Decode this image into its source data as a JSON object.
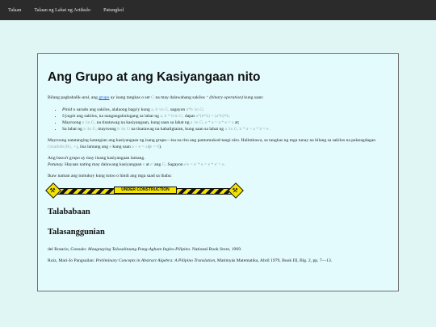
{
  "nav": {
    "items": [
      {
        "label": "Talaan"
      },
      {
        "label": "Talaan ng Lahat ng Artikulo"
      },
      {
        "label": "Patungkol"
      }
    ]
  },
  "article": {
    "title": "Ang Grupo at ang Kasiyangaan nito",
    "intro_before_link": "Bilang pagbabalik-aral, ang ",
    "intro_link": "grupo",
    "intro_after_link": " ay isang tangkas o set ",
    "intro_G": "G",
    "intro_mid": " na may dalawahang sakilos ",
    "intro_star": "*",
    "intro_binop": "(binary operation)",
    "intro_end": " kung saan:",
    "bullets": [
      {
        "term": "Pinid",
        "text_a": " o sarado ang sakilos, alalaong baga'y kung ",
        "math_a": "a, b \\in G,",
        "text_b": " sagayon ",
        "math_b": "a*b \\in G;"
      },
      {
        "term": "Uyugin",
        "text_a": " ang sakilos, na nangangahulugang sa lahat ng ",
        "math_a": "a, b * b\\in G,",
        "text_b": " dapat ",
        "math_b": "a*(b*k) = (a*b)*k;"
      },
      {
        "term": "",
        "text_a": "Mayroong ",
        "math_a": "e \\in G,",
        "text_b": " na tinatawag na kasiyangaan, kung saan sa lahat ng ",
        "math_b": "a \\in G, e * a = a * e = a",
        "text_c": " at;"
      },
      {
        "term": "",
        "text_a": "Sa lahat ng ",
        "math_a": "a \\in G,",
        "text_b": " mayroong ",
        "math_b": "b \\in G",
        "text_c": " na tinatawag na kabaligtaran, kung saan sa lahat ng ",
        "math_c": "a \\in G, b * a = a * b = e ."
      }
    ],
    "para2_a": "Mayroong natatanging katangian ang kasiyangaan ng isang grupo—isa na rito ang pamumukod-tangi nito. Halimbawa, sa tangkas ng mga tunay na bilang sa sakilos na palaragdagan ",
    "para2_math": "(\\mathbb{R}, +)",
    "para2_b": ", iisa lamang ang ",
    "para2_e": "e",
    "para2_c": " kung saan ",
    "para2_math2": "a + e = a",
    "para2_d": " (",
    "para2_math3": "e = 0",
    "para2_end": ").",
    "para3_line1": "Ang bawa't grupo ay may iisang kasiyangaan lamang.",
    "para3_patunay": "Patunay.",
    "para3_line2_a": " Hayaan nating may dalawang kasiyangaan ",
    "para3_e": "e",
    "para3_line2_b": " at ",
    "para3_e2": "e'",
    "para3_line2_c": " ang ",
    "para3_G": "G",
    "para3_line2_d": ". Sagayon ",
    "para3_math": "e'e = e' * e = e * e' = e.",
    "para4": "Ikaw naman ang tumukoy kung tutoo o hindi ang mga saad sa ibaba:",
    "under_construction": "UNDER CONSTRUCTION",
    "h_talababaan": "Talababaan",
    "h_talasanggunian": "Talasanggunian",
    "ref1_a": "del Rosario, Gonsalo: ",
    "ref1_title": "Maugnaying Talasalitaang Pang-Agham Ingles-Pilipino.",
    "ref1_b": " National Book Store, 1969.",
    "ref2_a": "Ruiz, Mari-Jo Pangsailan: ",
    "ref2_title": "Preliminary Concepts in Abstract Algebra: A Pilipino Translation,",
    "ref2_b": " Matimyás Matematika, Abril 1979, Buok III, Blg. 2, pp. 7—13."
  },
  "colors": {
    "page_bg": "#dff6f4",
    "navbar_bg": "#2b2b2b",
    "content_bg": "#e3fbfd",
    "link": "#1a57c8",
    "math": "#99aaaa"
  }
}
